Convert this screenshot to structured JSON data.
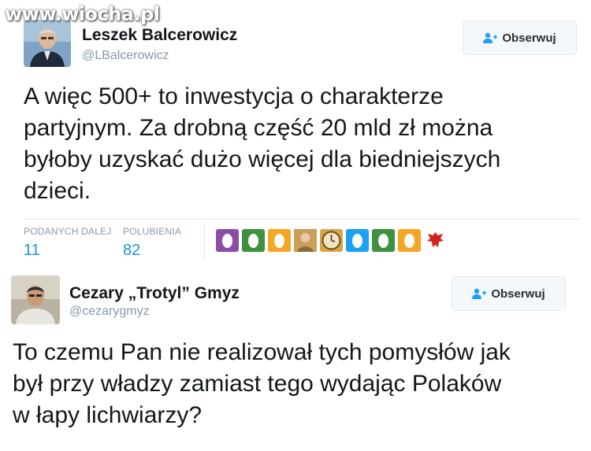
{
  "watermark": "www.wiocha.pl",
  "tweet1": {
    "display_name": "Leszek Balcerowicz",
    "handle": "@LBalcerowicz",
    "follow_label": "Obserwuj",
    "text": "A więc 500+ to inwestycja o charakterze\npartyjnym. Za drobną część 20 mld zł można\nbyłoby uzyskać dużo więcej dla biedniejszych\ndzieci.",
    "stats": {
      "retweets_label": "PODANYCH DALEJ",
      "retweets_value": "11",
      "likes_label": "POLUBIENIA",
      "likes_value": "82"
    },
    "likers": [
      {
        "type": "egg",
        "color": "#8b4ea6"
      },
      {
        "type": "egg",
        "color": "#3f9140"
      },
      {
        "type": "egg",
        "color": "#f5a623"
      },
      {
        "type": "photo",
        "color": "#c7a05a"
      },
      {
        "type": "clock",
        "color": "#d9a645"
      },
      {
        "type": "egg",
        "color": "#1da1f2"
      },
      {
        "type": "egg",
        "color": "#3f9140"
      },
      {
        "type": "egg",
        "color": "#f5a623"
      },
      {
        "type": "eagle",
        "color": "#d6231b"
      }
    ]
  },
  "tweet2": {
    "display_name": "Cezary „Trotyl” Gmyz",
    "handle": "@cezarygmyz",
    "follow_label": "Obserwuj",
    "text": "To czemu Pan nie realizował tych pomysłów jak\nbył przy władzy zamiast tego wydając Polaków\nw łapy lichwiarzy?"
  },
  "colors": {
    "link_blue": "#1b95e0",
    "muted": "#8899a6",
    "border": "#e1e8ed"
  }
}
